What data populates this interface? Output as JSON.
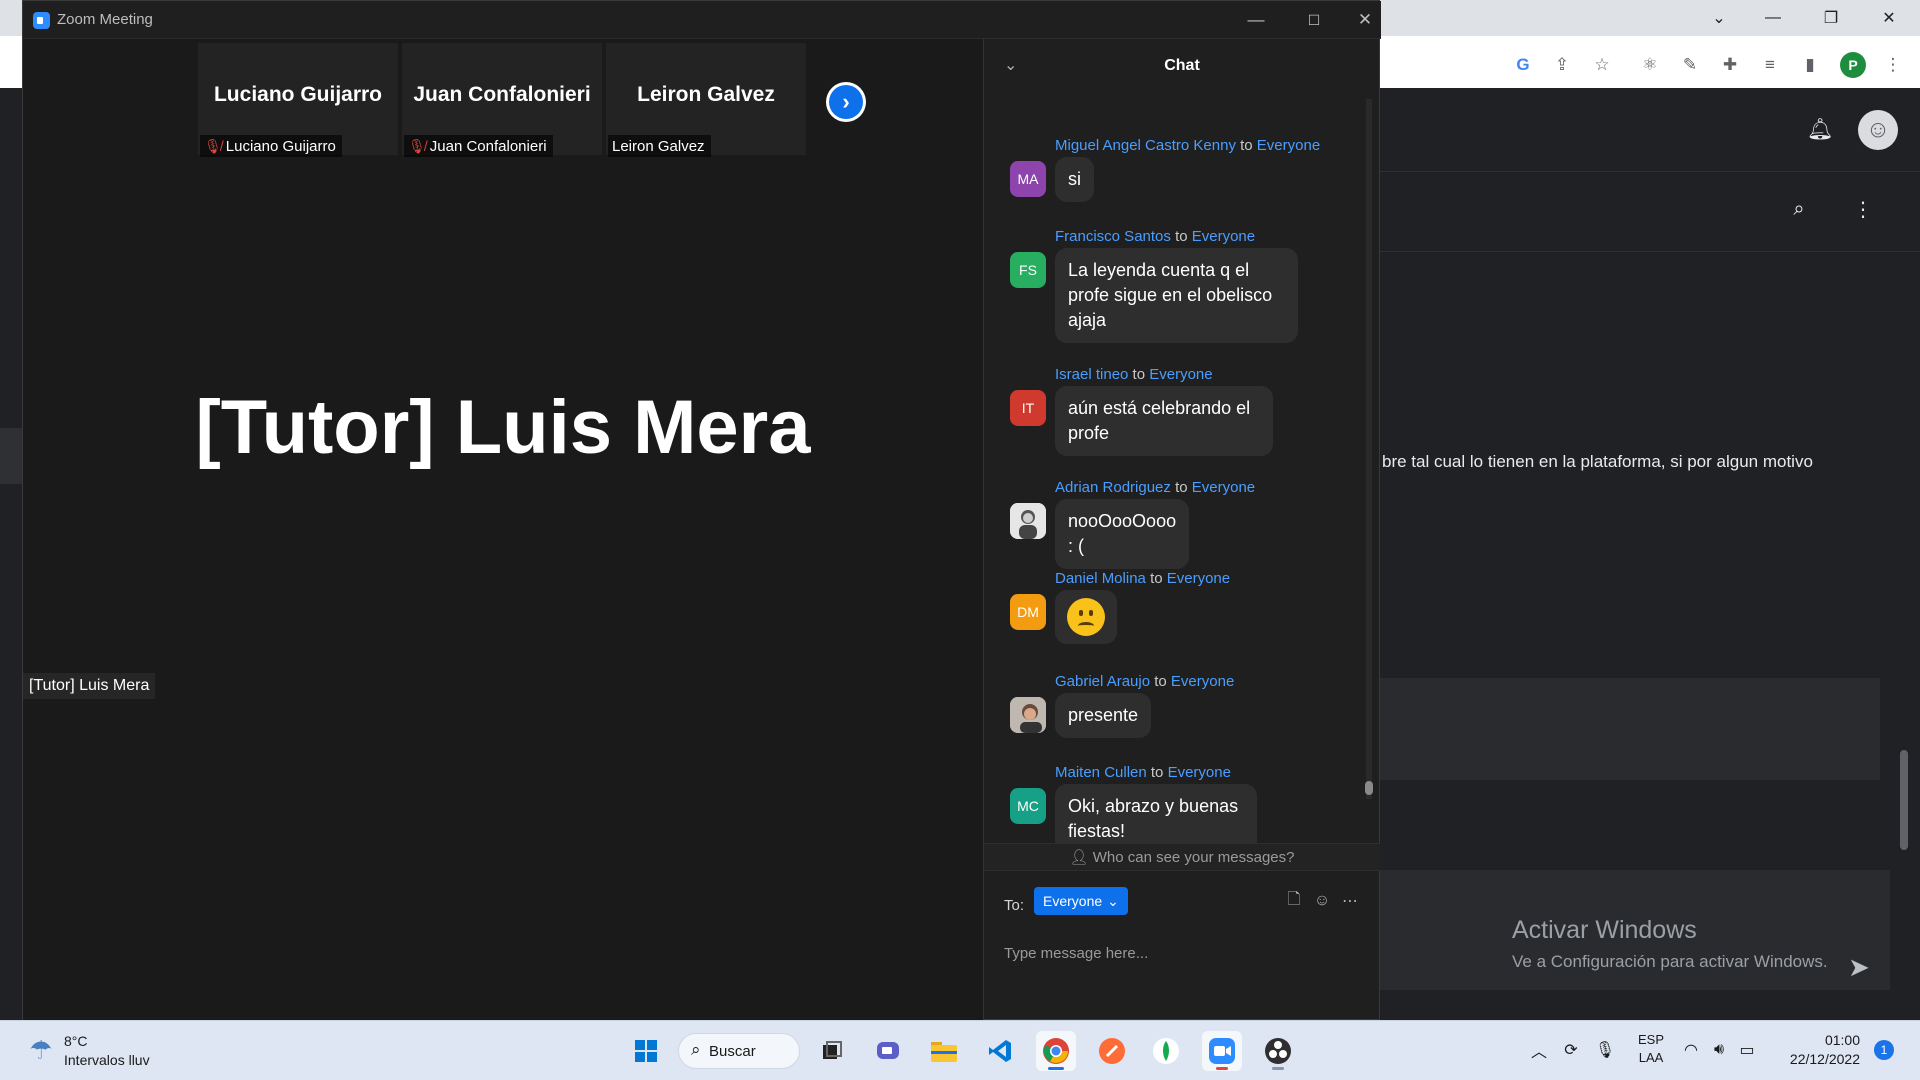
{
  "zoom": {
    "window_title": "Zoom Meeting",
    "thumbnails": [
      {
        "display_name": "Luciano Guijarro",
        "tag": "Luciano Guijarro",
        "muted": true
      },
      {
        "display_name": "Juan Confalonieri",
        "tag": "Juan Confalonieri",
        "muted": true
      },
      {
        "display_name": "Leiron Galvez",
        "tag": "Leiron Galvez",
        "muted": false
      }
    ],
    "active_speaker": {
      "name": "[Tutor] Luis Mera",
      "tag": "[Tutor] Luis Mera"
    }
  },
  "chat": {
    "title": "Chat",
    "messages": [
      {
        "sender": "Miguel Angel Castro Kenny",
        "to_word": "to",
        "recipient": "Everyone",
        "initials": "MA",
        "avatar_color": "#8e44ad",
        "text": "si"
      },
      {
        "sender": "Francisco Santos",
        "to_word": "to",
        "recipient": "Everyone",
        "initials": "FS",
        "avatar_color": "#27ae60",
        "text": "La leyenda cuenta q el profe sigue en el obelisco ajaja"
      },
      {
        "sender": "Israel tineo",
        "to_word": "to",
        "recipient": "Everyone",
        "initials": "IT",
        "avatar_color": "#d0392e",
        "text": "aún está celebrando el profe"
      },
      {
        "sender": "Adrian Rodriguez",
        "to_word": "to",
        "recipient": "Everyone",
        "initials": "",
        "avatar_color": "#d9d9d9",
        "text": "nooOooOooo : ("
      },
      {
        "sender": "Daniel Molina",
        "to_word": "to",
        "recipient": "Everyone",
        "initials": "DM",
        "avatar_color": "#f39c12",
        "text": "",
        "emoji": "slightly-frowning-face"
      },
      {
        "sender": "Gabriel Araujo",
        "to_word": "to",
        "recipient": "Everyone",
        "initials": "",
        "avatar_color": "#c8c8c8",
        "text": "presente"
      },
      {
        "sender": "Maiten Cullen",
        "to_word": "to",
        "recipient": "Everyone",
        "initials": "MC",
        "avatar_color": "#16a085",
        "text": "Oki, abrazo y buenas fiestas!"
      }
    ],
    "who_can_see": "Who can see your messages?",
    "to_label": "To:",
    "recipient_selected": "Everyone",
    "input_placeholder": "Type message here..."
  },
  "browser": {
    "page_text": "bre tal cual lo tienen en la plataforma, si por algun motivo",
    "activate_title": "Activar Windows",
    "activate_subtitle": "Ve a Configuración para activar Windows.",
    "profile_initial": "P"
  },
  "taskbar": {
    "weather_temp": "8°C",
    "weather_desc": "Intervalos lluv",
    "search_label": "Buscar",
    "lang_line1": "ESP",
    "lang_line2": "LAA",
    "time": "01:00",
    "date": "22/12/2022",
    "notification_count": "1"
  }
}
